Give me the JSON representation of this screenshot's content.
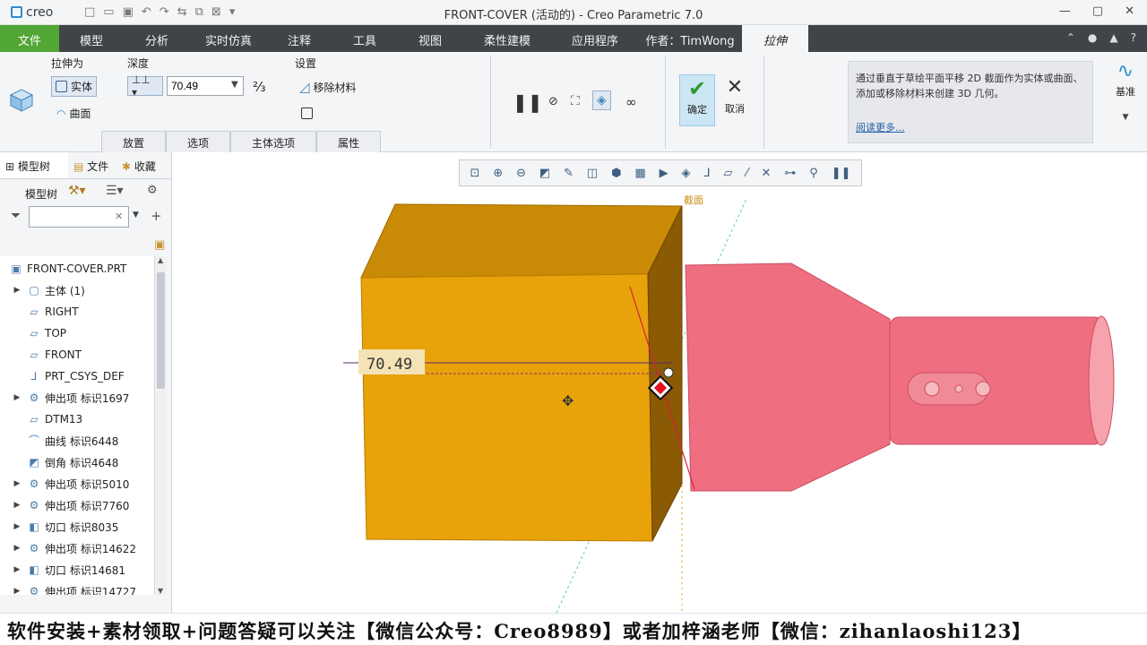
{
  "app": {
    "logo": "creo",
    "window_title": "FRONT-COVER (活动的) - Creo Parametric 7.0"
  },
  "tabs": {
    "file": "文件",
    "model": "模型",
    "analysis": "分析",
    "simulate": "实时仿真",
    "annotate": "注释",
    "tools": "工具",
    "view": "视图",
    "flexible": "柔性建模",
    "apps": "应用程序",
    "author": "作者：TimWong",
    "extrude": "拉伸"
  },
  "ribbon": {
    "extrude_as_label": "拉伸为",
    "solid_label": "实体",
    "surface_label": "曲面",
    "depth_label": "深度",
    "depth_value": "70.49",
    "settings_label": "设置",
    "remove_material_label": "移除材料",
    "ok_label": "确定",
    "cancel_label": "取消",
    "datum_label": "基准",
    "subtabs": [
      "放置",
      "选项",
      "主体选项",
      "属性"
    ]
  },
  "help": {
    "text": "通过垂直于草绘平面平移 2D 截面作为实体或曲面、添加或移除材料来创建 3D 几何。",
    "link": "阅读更多..."
  },
  "leftpanel": {
    "tabs": [
      "模型树",
      "文件",
      "收藏"
    ],
    "tree_label": "模型树",
    "root": "FRONT-COVER.PRT",
    "items": [
      {
        "label": "主体 (1)",
        "expand": true,
        "icon": "body-icon"
      },
      {
        "label": "RIGHT",
        "expand": false,
        "icon": "datum-plane-icon"
      },
      {
        "label": "TOP",
        "expand": false,
        "icon": "datum-plane-icon"
      },
      {
        "label": "FRONT",
        "expand": false,
        "icon": "datum-plane-icon"
      },
      {
        "label": "PRT_CSYS_DEF",
        "expand": false,
        "icon": "csys-icon"
      },
      {
        "label": "伸出项 标识1697",
        "expand": true,
        "icon": "protrusion-icon"
      },
      {
        "label": "DTM13",
        "expand": false,
        "icon": "datum-plane-icon"
      },
      {
        "label": "曲线 标识6448",
        "expand": false,
        "icon": "curve-icon"
      },
      {
        "label": "倒角 标识4648",
        "expand": false,
        "icon": "chamfer-icon"
      },
      {
        "label": "伸出项 标识5010",
        "expand": true,
        "icon": "protrusion-icon"
      },
      {
        "label": "伸出项 标识7760",
        "expand": true,
        "icon": "protrusion-icon"
      },
      {
        "label": "切口 标识8035",
        "expand": true,
        "icon": "cut-icon"
      },
      {
        "label": "伸出项 标识14622",
        "expand": true,
        "icon": "protrusion-icon"
      },
      {
        "label": "切口 标识14681",
        "expand": true,
        "icon": "cut-icon"
      },
      {
        "label": "伸出项 标识14727",
        "expand": true,
        "icon": "protrusion-icon"
      }
    ]
  },
  "viewport": {
    "dimension_value": "70.49",
    "section_label": "截面",
    "box_color": "#e8a20a",
    "part_color": "#ef6f80"
  },
  "caption": "软件安装+素材领取+问题答疑可以关注【微信公众号：Creo8989】或者加梓涵老师【微信：zihanlaoshi123】"
}
